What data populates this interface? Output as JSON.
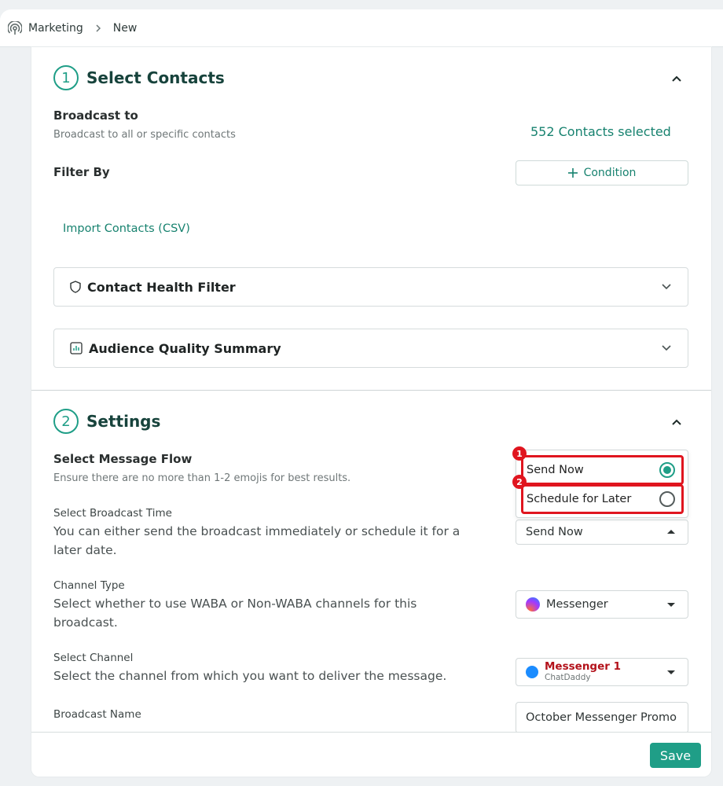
{
  "breadcrumb": {
    "section": "Marketing",
    "page": "New"
  },
  "select_contacts": {
    "step_number": "1",
    "title": "Select Contacts",
    "broadcast_to_label": "Broadcast to",
    "broadcast_to_desc": "Broadcast to all or specific contacts",
    "contacts_selected": "552 Contacts selected",
    "filter_by_label": "Filter By",
    "condition_button": "Condition",
    "import_contacts": "Import Contacts (CSV)",
    "health_filter": "Contact Health Filter",
    "audience_summary": "Audience Quality Summary"
  },
  "settings": {
    "step_number": "2",
    "title": "Settings",
    "message_flow_label": "Select Message Flow",
    "message_flow_desc": "Ensure there are no more than 1-2 emojis for best results.",
    "broadcast_time_label": "Select Broadcast Time",
    "broadcast_time_desc_1": "You can either send the broadcast immediately or schedule it for a",
    "broadcast_time_desc_2": "later date.",
    "broadcast_time_value": "Send Now",
    "time_options": [
      {
        "label": "Send Now",
        "selected": true,
        "badge": "1"
      },
      {
        "label": "Schedule for Later",
        "selected": false,
        "badge": "2"
      }
    ],
    "channel_type_label": "Channel Type",
    "channel_type_desc_1": "Select whether to use WABA or Non-WABA channels for this",
    "channel_type_desc_2": "broadcast.",
    "channel_type_value": "Messenger",
    "channel_label": "Select Channel",
    "channel_desc": "Select the channel from which you want to deliver the message.",
    "channel_name": "Messenger 1",
    "channel_sub": "ChatDaddy",
    "broadcast_name_label": "Broadcast Name",
    "broadcast_name_value": "October Messenger Promo"
  },
  "footer": {
    "save": "Save"
  },
  "colors": {
    "accent": "#1f9e87",
    "highlight": "#e0151f",
    "channel_name": "#b3121b"
  },
  "icons": [
    "broadcast-icon",
    "chevron-right-icon",
    "chevron-up-icon",
    "chevron-down-icon",
    "plus-icon",
    "shield-icon",
    "chart-icon",
    "messenger-icon",
    "dropdown-arrow-icon"
  ]
}
